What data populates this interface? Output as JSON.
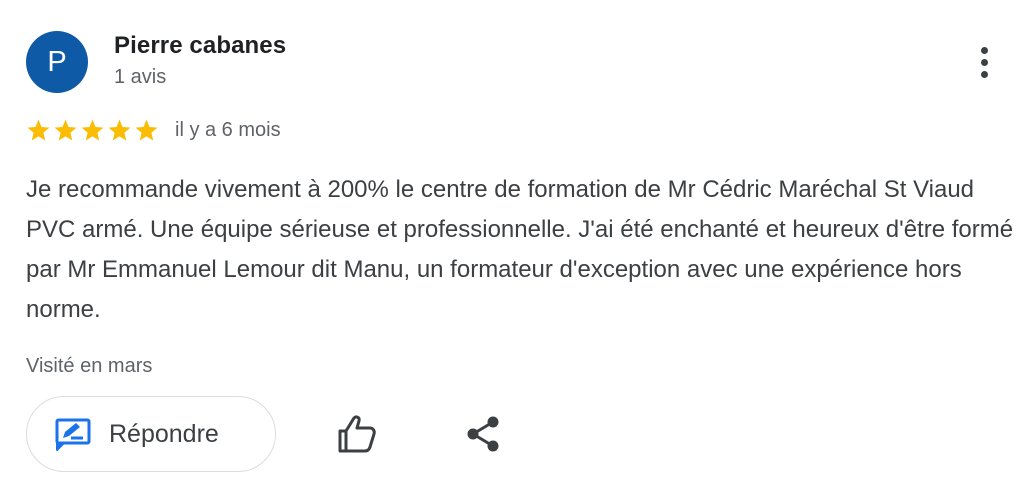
{
  "review": {
    "avatar_letter": "P",
    "avatar_color": "#0f5aa6",
    "author": "Pierre cabanes",
    "review_count": "1 avis",
    "rating": 5,
    "rating_max": 5,
    "star_color": "#fbbc04",
    "date": "il y a 6 mois",
    "text": "Je recommande vivement à 200% le centre de formation de Mr Cédric Maréchal St Viaud PVC armé. Une équipe sérieuse et professionnelle. J'ai été enchanté et heureux d'être formé par Mr Emmanuel Lemour dit Manu, un formateur d'exception avec une expérience hors norme.",
    "visited": "Visité en mars"
  },
  "actions": {
    "reply_label": "Répondre",
    "reply_icon": "reply-edit-icon",
    "reply_icon_color": "#1a73e8",
    "like_icon": "thumbs-up-icon",
    "share_icon": "share-icon",
    "more_icon": "more-vertical-icon"
  }
}
